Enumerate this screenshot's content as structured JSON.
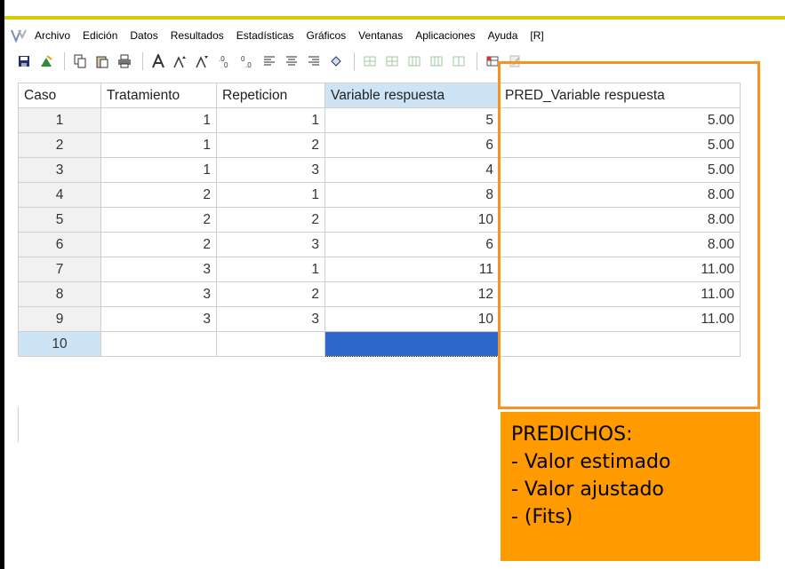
{
  "menu": [
    "Archivo",
    "Edición",
    "Datos",
    "Resultados",
    "Estadísticas",
    "Gráficos",
    "Ventanas",
    "Aplicaciones",
    "Ayuda",
    "[R]"
  ],
  "toolbar": {
    "icons": [
      "save-icon",
      "open-icon",
      "copy-icon",
      "paste-icon",
      "print-icon",
      "font-icon",
      "font-increase-icon",
      "font-decrease-icon",
      "decimals-increase-icon",
      "decimals-decrease-icon",
      "align-left-icon",
      "align-center-icon",
      "align-right-icon",
      "fill-icon",
      "insert-row-icon",
      "delete-row-icon",
      "insert-column-icon",
      "add-column-icon",
      "delete-column-icon",
      "transpose-icon",
      "edit-note-icon"
    ]
  },
  "table": {
    "headers": [
      "Caso",
      "Tratamiento",
      "Repeticion",
      "Variable respuesta",
      "PRED_Variable respuesta"
    ],
    "rows": [
      [
        "1",
        "1",
        "1",
        "5",
        "5.00"
      ],
      [
        "2",
        "1",
        "2",
        "6",
        "5.00"
      ],
      [
        "3",
        "1",
        "3",
        "4",
        "5.00"
      ],
      [
        "4",
        "2",
        "1",
        "8",
        "8.00"
      ],
      [
        "5",
        "2",
        "2",
        "10",
        "8.00"
      ],
      [
        "6",
        "2",
        "3",
        "6",
        "8.00"
      ],
      [
        "7",
        "3",
        "1",
        "11",
        "11.00"
      ],
      [
        "8",
        "3",
        "2",
        "12",
        "11.00"
      ],
      [
        "9",
        "3",
        "3",
        "10",
        "11.00"
      ],
      [
        "10",
        "",
        "",
        "",
        ""
      ]
    ]
  },
  "callout": {
    "lines": [
      "PREDICHOS:",
      "- Valor estimado",
      "- Valor ajustado",
      "- (Fits)"
    ]
  },
  "colors": {
    "frame_top": "#d6ca00",
    "highlight_box": "#f7941d",
    "callout_bg": "#ff9a00",
    "selected_header": "#cde4f7",
    "active_cell": "#2f66c9"
  }
}
